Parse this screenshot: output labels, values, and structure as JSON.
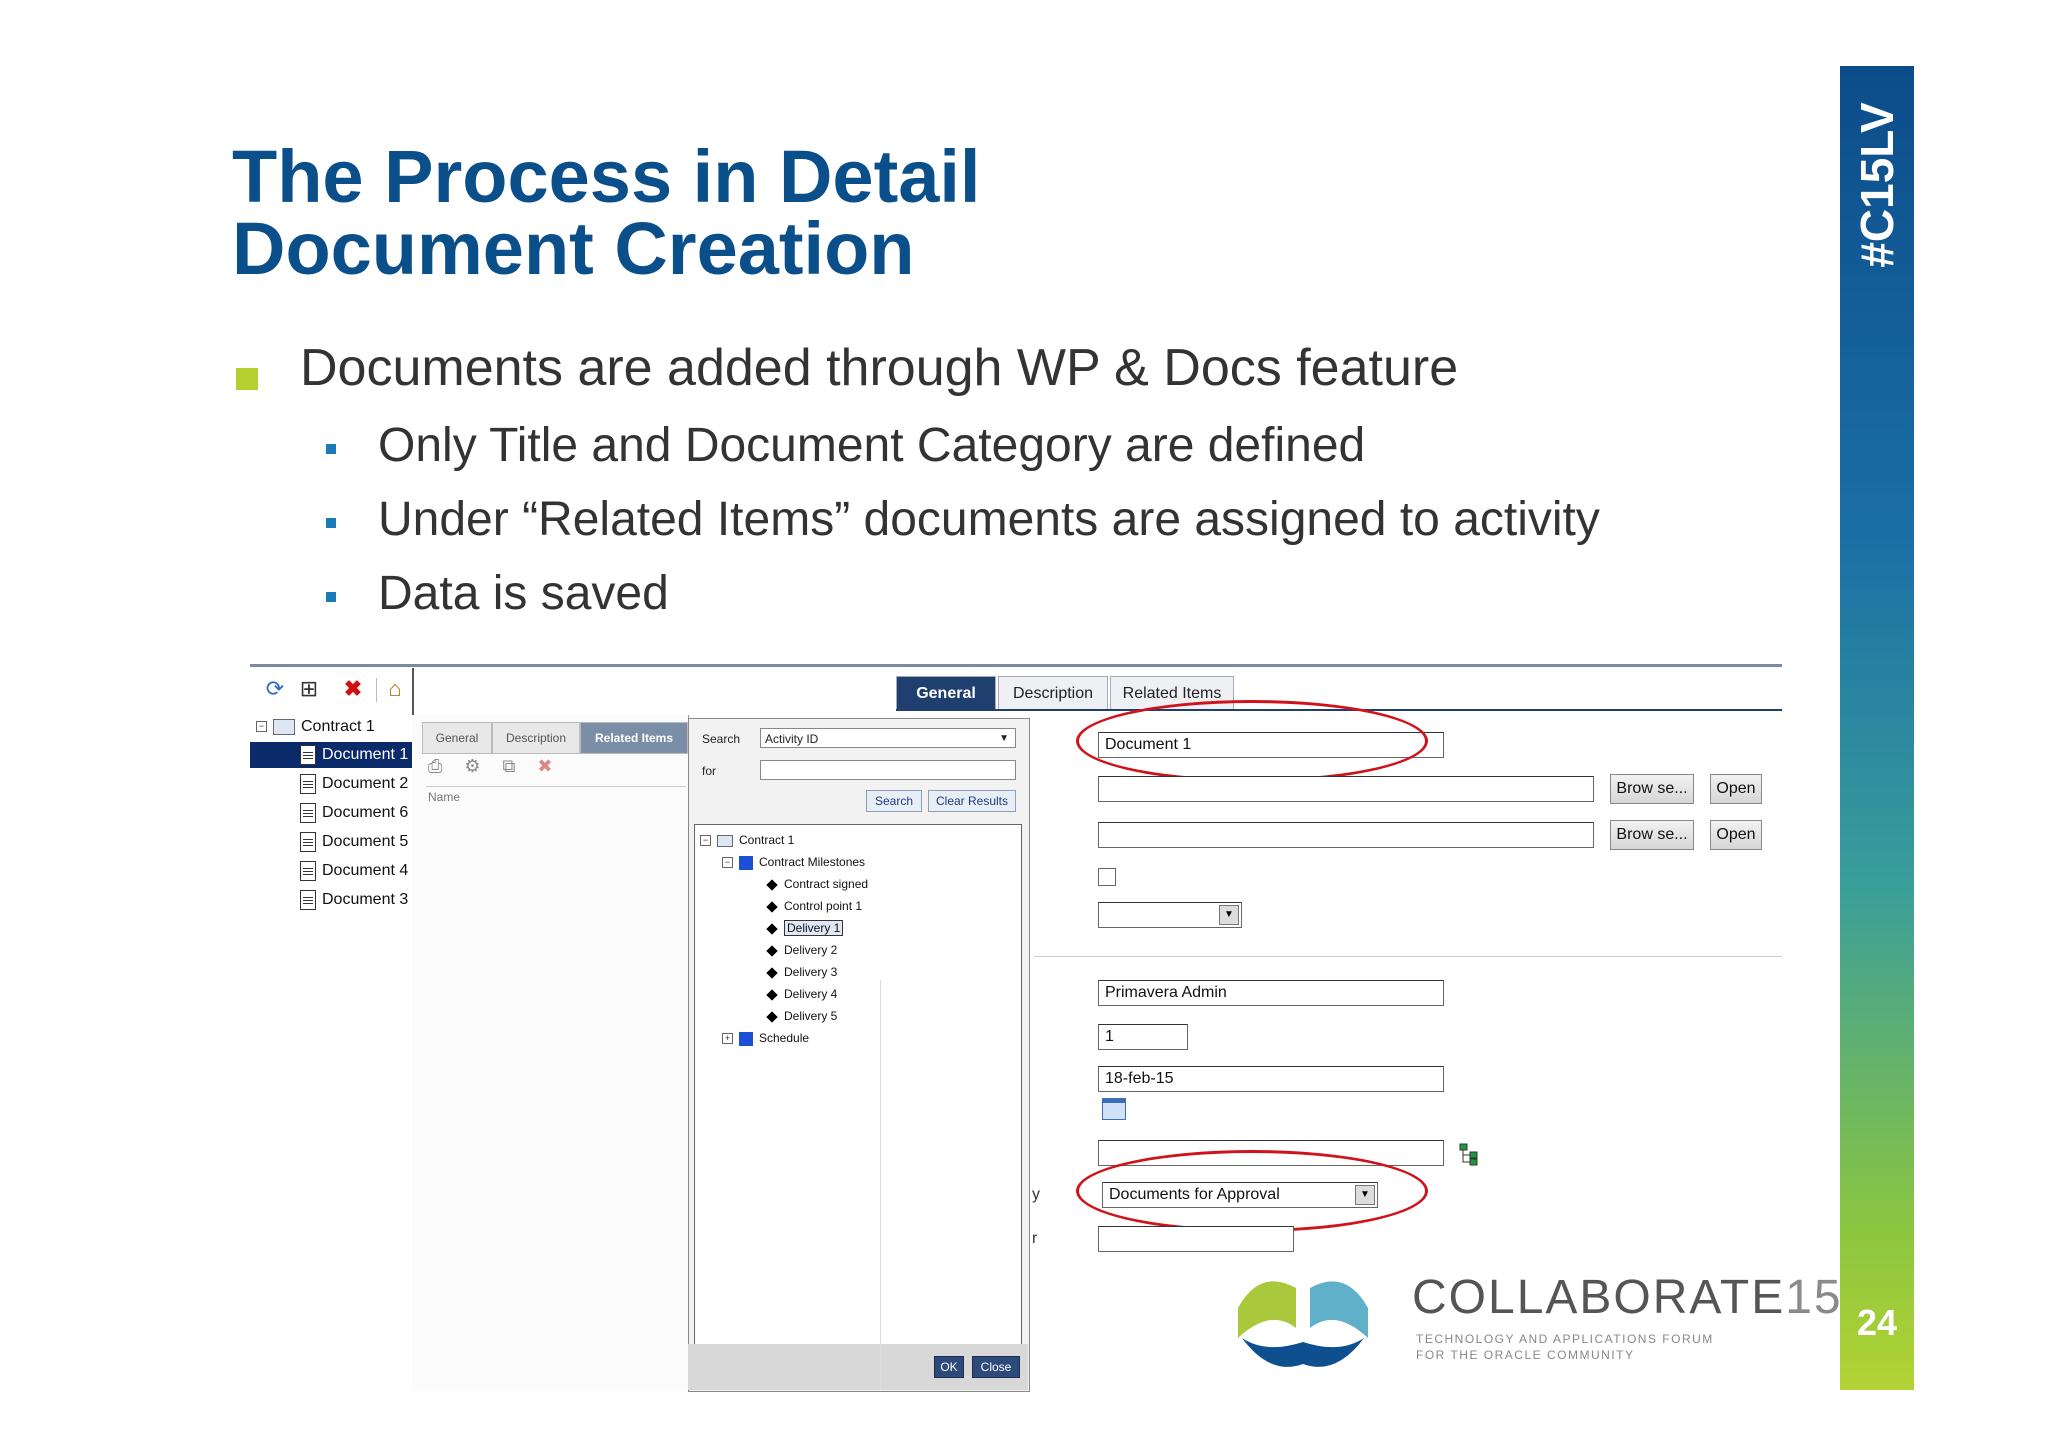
{
  "slide": {
    "title_line1": "The Process in Detail",
    "title_line2": "Document Creation",
    "bullet_main": "Documents are added through WP & Docs feature",
    "sub_bullets": [
      "Only Title and Document Category are defined",
      "Under “Related Items” documents are assigned to activity",
      "Data is saved"
    ],
    "hashtag": "#C15LV",
    "page_number": "24"
  },
  "colors": {
    "title": "#0b4f8a",
    "bullet_main": "#b5cf2f",
    "sub_bullet": "#1b7ab8",
    "highlight_oval": "#d0121a",
    "selected_row": "#0a2a6a"
  },
  "left_panel": {
    "toolbar_icons": [
      "refresh-icon",
      "add-document-icon",
      "delete-icon",
      "folder-home-icon"
    ],
    "tree": {
      "root": "Contract 1",
      "items": [
        "Document 1",
        "Document 2",
        "Document 6",
        "Document 5",
        "Document 4",
        "Document 3"
      ],
      "selected_index": 0
    }
  },
  "middle_panel": {
    "tabs": [
      "General",
      "Description",
      "Related Items"
    ],
    "active_tab": "Related Items",
    "column_header": "Name"
  },
  "dialog": {
    "search_label": "Search",
    "search_field_value": "Activity ID",
    "for_label": "for",
    "for_value": "",
    "search_button": "Search",
    "clear_button": "Clear Results",
    "tree": {
      "root": "Contract 1",
      "milestones": "Contract Milestones",
      "items": [
        "Contract signed",
        "Control point 1",
        "Delivery 1",
        "Delivery 2",
        "Delivery 3",
        "Delivery 4",
        "Delivery 5"
      ],
      "selected": "Delivery 1",
      "schedule": "Schedule"
    },
    "ok_button": "OK",
    "close_button": "Close"
  },
  "main_form": {
    "tabs": [
      "General",
      "Description",
      "Related Items"
    ],
    "active_tab": "General",
    "title_value": "Document 1",
    "file_field_1": "",
    "file_field_2": "",
    "browse_label": "Brow se...",
    "open_label": "Open",
    "author_value": "Primavera Admin",
    "revision_value": "1",
    "date_value": "18-feb-15",
    "category_value": "Documents for Approval",
    "partial_label_1": "y",
    "partial_label_2": "r"
  },
  "logo": {
    "brand": "COLLABORATE",
    "brand_number": "15",
    "tagline_1": "TECHNOLOGY AND APPLICATIONS FORUM",
    "tagline_2": "FOR THE ORACLE COMMUNITY"
  }
}
